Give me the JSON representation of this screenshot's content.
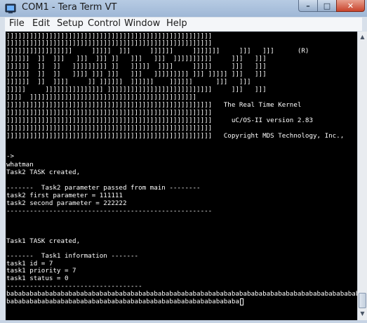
{
  "window": {
    "title": "COM1 - Tera Term VT",
    "buttons": {
      "minimize": "–",
      "maximize": "□",
      "close": "✕"
    }
  },
  "menu": [
    "File",
    "Edit",
    "Setup",
    "Control",
    "Window",
    "Help"
  ],
  "terminal": {
    "lines": [
      "]]]]]]]]]]]]]]]]]]]]]]]]]]]]]]]]]]]]]]]]]]]]]]]]]]]]]",
      "]]]]]]]]]]]]]]]]]]]]]]]]]]]]]]]]]]]]]]]]]]]]]]]]]]]]]",
      "]]]]]]]]]]]]]]]]]     ]]]]]  ]]]     ]]]]]]     ]]]]]]]     ]]]   ]]]      (R)",
      "]]]]]]  ]]  ]]]   ]]]  ]]] ]]   ]]]   ]]]  ]]]]]]]]]]     ]]]   ]]]",
      "]]]]]]  ]]  ]]   ]]]]]]]]] ]]   ]]]]]  ]]]]     ]]]]]     ]]]   ]]]",
      "]]]]]]  ]]  ]]   ]]]] ]]] ]]]   ]]]   ]]]]]]]]] ]]] ]]]]] ]]]   ]]]",
      "]]]]]]  ]]  ]]]]     ]] ]]]]]]  ]]]]]]    ]]]]]]      ]]]   ]]]",
      "]]]]]     ]]]]]]]]]]]]]]] ]]]]]]]]]]]]]]]]]]]]]]]]]]]     ]]]   ]]]",
      "]]]]  ]]]]]]]]]]]]]]]]]]]]]]]]]]]]]]]]]]]]]]]]]]]",
      "]]]]]]]]]]]]]]]]]]]]]]]]]]]]]]]]]]]]]]]]]]]]]]]]]]]]]   The Real Time Kernel",
      "]]]]]]]]]]]]]]]]]]]]]]]]]]]]]]]]]]]]]]]]]]]]]]]]]]]]]",
      "]]]]]]]]]]]]]]]]]]]]]]]]]]]]]]]]]]]]]]]]]]]]]]]]]]]]]     uC/OS-II version 2.83",
      "]]]]]]]]]]]]]]]]]]]]]]]]]]]]]]]]]]]]]]]]]]]]]]]]]]]]]",
      "]]]]]]]]]]]]]]]]]]]]]]]]]]]]]]]]]]]]]]]]]]]]]]]]]]]]]   Copyright MDS Technology, Inc.,",
      "",
      "->",
      "whatman",
      "Task2 TASK created,",
      "",
      "-------  Task2 parameter passed from main --------",
      "task2 first parameter = 111111",
      "task2 second parameter = 222222",
      "-----------------------------------------------------",
      "",
      "",
      "",
      "Task1 TASK created,",
      "",
      "-------  Task1 information -------",
      "task1 id = 7",
      "task1 priority = 7",
      "task1 status = 0",
      "-----------------------------------",
      "bababababababababababababababababababababababababababababababababababababababababababababababababa",
      "babababababababababababababababababababababababababababababa"
    ]
  }
}
